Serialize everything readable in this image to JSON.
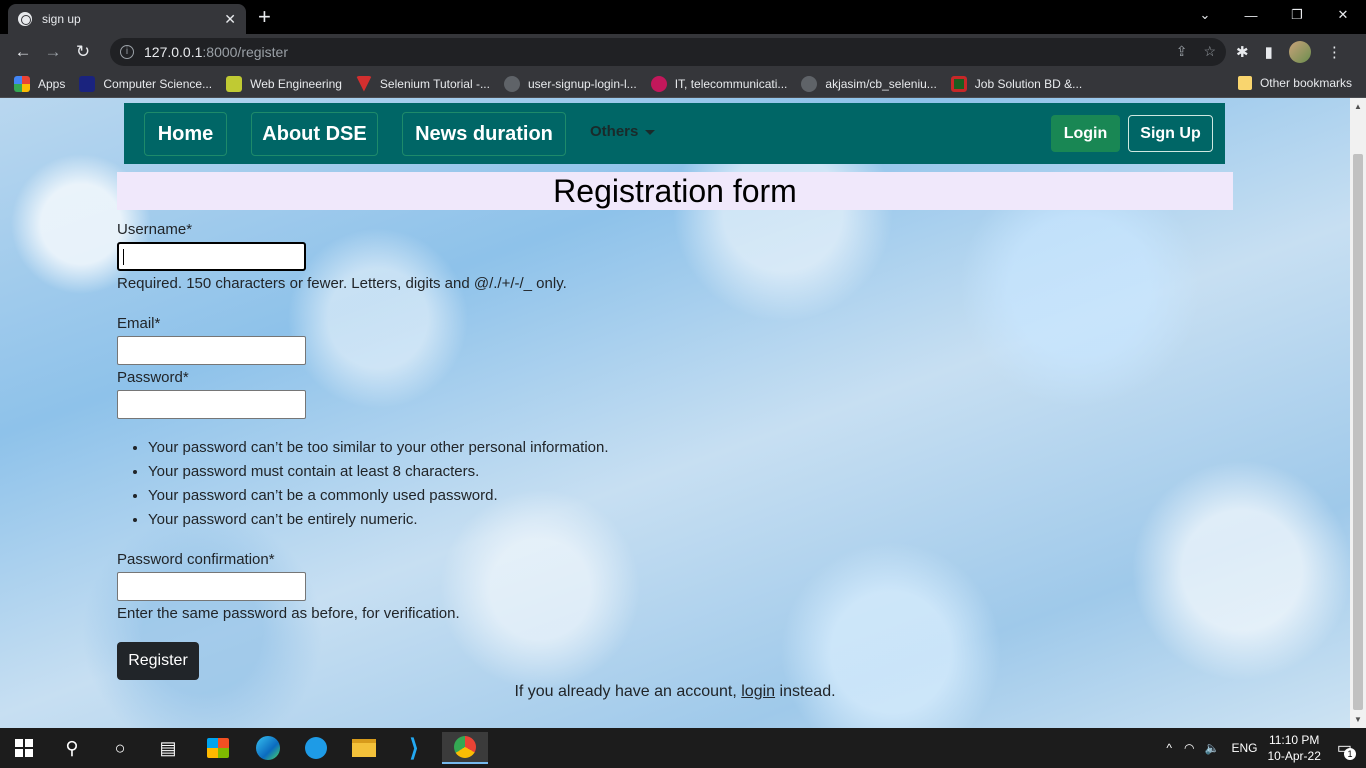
{
  "browser": {
    "tab_title": "sign up",
    "url_host": "127.0.0.1",
    "url_rest": ":8000/register",
    "bookmarks": [
      {
        "label": "Apps",
        "color": "#ea4335"
      },
      {
        "label": "Computer Science...",
        "color": "#1a237e"
      },
      {
        "label": "Web Engineering",
        "color": "#c0ca33"
      },
      {
        "label": "Selenium Tutorial -...",
        "color": "#d32f2f"
      },
      {
        "label": "user-signup-login-l...",
        "color": "#5f6368"
      },
      {
        "label": "IT, telecommunicati...",
        "color": "#c2185b"
      },
      {
        "label": "akjasim/cb_seleniu...",
        "color": "#5f6368"
      },
      {
        "label": "Job Solution BD &...",
        "color": "#c62828"
      }
    ],
    "other_bookmarks": "Other bookmarks"
  },
  "navbar": {
    "home": "Home",
    "about": "About DSE",
    "news": "News duration",
    "others": "Others",
    "login": "Login",
    "signup": "Sign Up"
  },
  "form": {
    "title": "Registration form",
    "username_label": "Username*",
    "username_help": "Required. 150 characters or fewer. Letters, digits and @/./+/-/_ only.",
    "email_label": "Email*",
    "password_label": "Password*",
    "password_rules": [
      "Your password can’t be too similar to your other personal information.",
      "Your password must contain at least 8 characters.",
      "Your password can’t be a commonly used password.",
      "Your password can’t be entirely numeric."
    ],
    "confirm_label": "Password confirmation*",
    "confirm_help": "Enter the same password as before, for verification.",
    "register_button": "Register",
    "already_prefix": "If you already have an account, ",
    "already_link": "login",
    "already_suffix": " instead."
  },
  "taskbar": {
    "lang": "ENG",
    "time": "11:10 PM",
    "date": "10-Apr-22",
    "notifications": "1"
  }
}
